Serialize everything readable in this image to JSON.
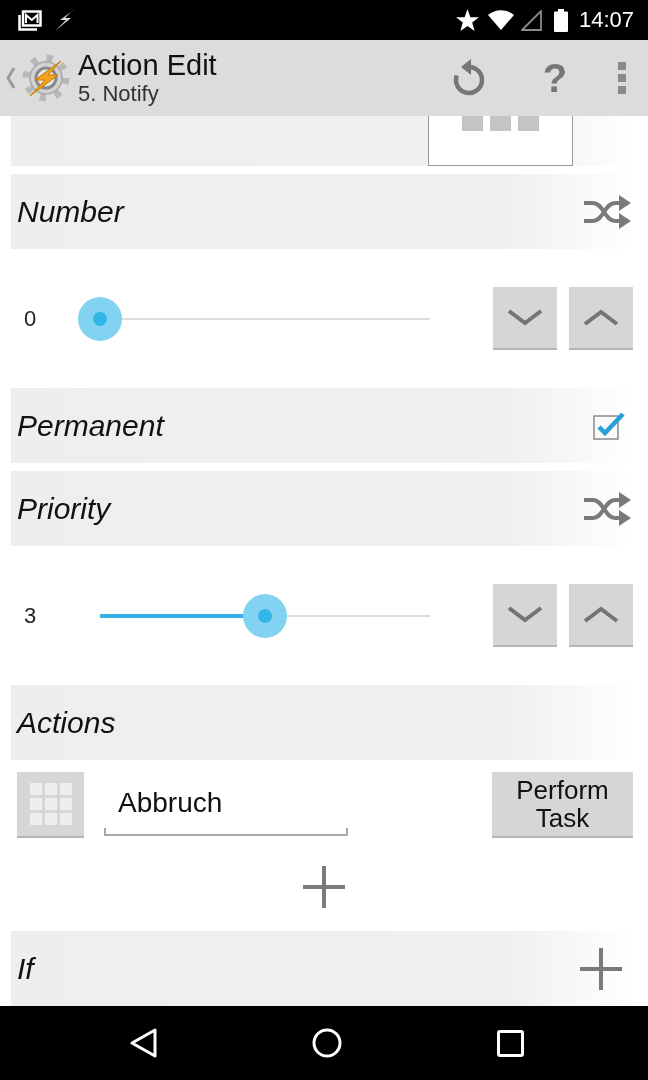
{
  "status_bar": {
    "time": "14:07"
  },
  "app_bar": {
    "title": "Action Edit",
    "subtitle": "5. Notify",
    "help": "?"
  },
  "sections": [
    {
      "kind": "cut_off"
    },
    {
      "kind": "shuffle_header",
      "label": "Number"
    },
    {
      "kind": "slider",
      "reading": "0",
      "level": 0
    },
    {
      "kind": "checkbox_header",
      "label": "Permanent",
      "checked": true
    },
    {
      "kind": "shuffle_header",
      "label": "Priority"
    },
    {
      "kind": "slider",
      "reading": "3",
      "level": 0.5
    },
    {
      "kind": "plain_header",
      "label": "Actions"
    },
    {
      "kind": "task",
      "value": "Abbruch",
      "button": "Perform Task"
    },
    {
      "kind": "add_row"
    },
    {
      "kind": "add_header",
      "label": "If"
    }
  ]
}
